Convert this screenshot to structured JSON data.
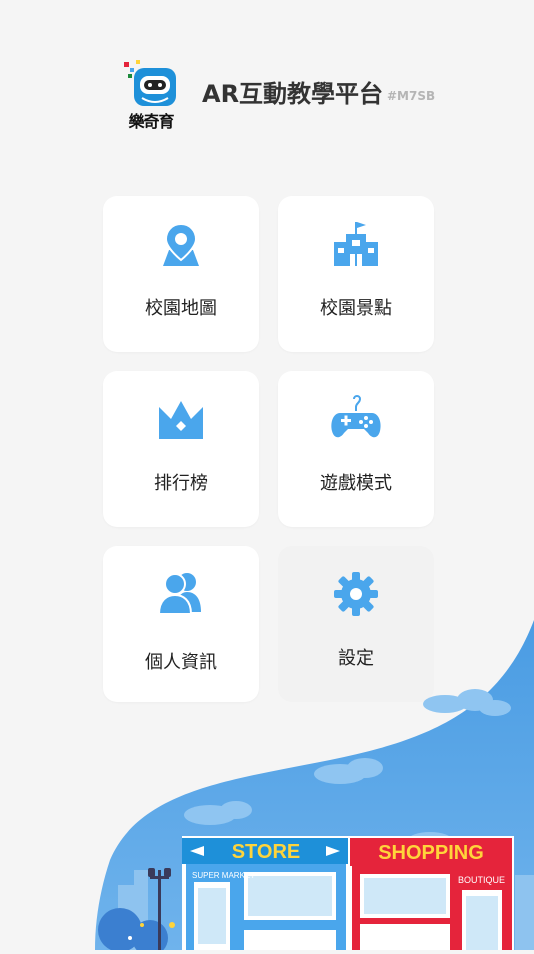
{
  "app": {
    "logo_text": "樂奇育",
    "title": "AR互動教學平台",
    "code": "#M7SB"
  },
  "menu": [
    {
      "label": "校園地圖",
      "icon": "map-pin-icon"
    },
    {
      "label": "校園景點",
      "icon": "school-building-icon"
    },
    {
      "label": "排行榜",
      "icon": "crown-icon"
    },
    {
      "label": "遊戲模式",
      "icon": "game-controller-icon"
    },
    {
      "label": "個人資訊",
      "icon": "users-icon"
    },
    {
      "label": "設定",
      "icon": "gear-icon"
    }
  ],
  "scene": {
    "store_sign": "STORE",
    "shopping_sign": "SHOPPING",
    "super_market": "SUPER MARKET",
    "boutique": "BOUTIQUE"
  },
  "colors": {
    "accent_blue": "#4aa6ec",
    "sky_blue": "#4a9ce3",
    "shop_red": "#e5243b",
    "sign_yellow": "#ffd43b"
  }
}
